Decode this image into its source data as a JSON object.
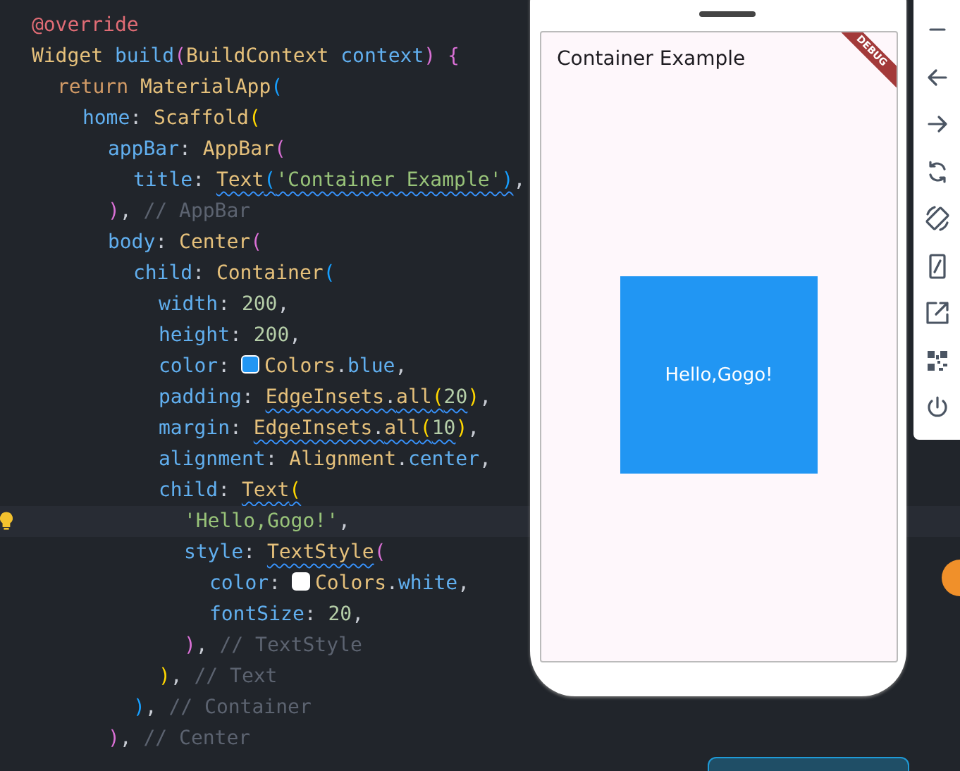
{
  "editor": {
    "lines": [
      {
        "tokens": [
          {
            "t": "@override",
            "kind": "deco"
          }
        ]
      },
      {
        "tokens": [
          {
            "t": "Widget ",
            "kind": "type"
          },
          {
            "t": "build",
            "kind": "fn"
          },
          {
            "t": "(",
            "kind": "b1"
          },
          {
            "t": "BuildContext ",
            "kind": "type"
          },
          {
            "t": "context",
            "kind": "fn"
          },
          {
            "t": ") {",
            "kind": "b1"
          }
        ],
        "children": [
          {
            "tokens": [
              {
                "t": "return ",
                "kind": "kw"
              },
              {
                "t": "MaterialApp",
                "kind": "type"
              },
              {
                "t": "(",
                "kind": "b3"
              }
            ],
            "children": [
              {
                "tokens": [
                  {
                    "t": "home",
                    "kind": "prop"
                  },
                  {
                    "t": ": ",
                    "kind": "punct"
                  },
                  {
                    "t": "Scaffold",
                    "kind": "type"
                  },
                  {
                    "t": "(",
                    "kind": "b2"
                  }
                ],
                "children": [
                  {
                    "tokens": [
                      {
                        "t": "appBar",
                        "kind": "prop"
                      },
                      {
                        "t": ": ",
                        "kind": "punct"
                      },
                      {
                        "t": "AppBar",
                        "kind": "type"
                      },
                      {
                        "t": "(",
                        "kind": "b1"
                      }
                    ],
                    "children": [
                      {
                        "tokens": [
                          {
                            "t": "title",
                            "kind": "prop"
                          },
                          {
                            "t": ": ",
                            "kind": "punct"
                          },
                          {
                            "t": "Text",
                            "kind": "type",
                            "warn": true
                          },
                          {
                            "t": "(",
                            "kind": "b3",
                            "warn": true
                          },
                          {
                            "t": "'Container Example'",
                            "kind": "str",
                            "warn": true
                          },
                          {
                            "t": ")",
                            "kind": "b3",
                            "warn": true
                          },
                          {
                            "t": ",",
                            "kind": "punct"
                          }
                        ]
                      }
                    ]
                  },
                  {
                    "tokens": [
                      {
                        "t": ")",
                        "kind": "b1"
                      },
                      {
                        "t": ", ",
                        "kind": "punct"
                      },
                      {
                        "t": "// AppBar",
                        "kind": "comment"
                      }
                    ]
                  },
                  {
                    "tokens": [
                      {
                        "t": "body",
                        "kind": "prop"
                      },
                      {
                        "t": ": ",
                        "kind": "punct"
                      },
                      {
                        "t": "Center",
                        "kind": "type"
                      },
                      {
                        "t": "(",
                        "kind": "b1"
                      }
                    ],
                    "children": [
                      {
                        "tokens": [
                          {
                            "t": "child",
                            "kind": "prop"
                          },
                          {
                            "t": ": ",
                            "kind": "punct"
                          },
                          {
                            "t": "Container",
                            "kind": "type"
                          },
                          {
                            "t": "(",
                            "kind": "b3"
                          }
                        ],
                        "children": [
                          {
                            "tokens": [
                              {
                                "t": "width",
                                "kind": "prop"
                              },
                              {
                                "t": ": ",
                                "kind": "punct"
                              },
                              {
                                "t": "200",
                                "kind": "num"
                              },
                              {
                                "t": ",",
                                "kind": "punct"
                              }
                            ]
                          },
                          {
                            "tokens": [
                              {
                                "t": "height",
                                "kind": "prop"
                              },
                              {
                                "t": ": ",
                                "kind": "punct"
                              },
                              {
                                "t": "200",
                                "kind": "num"
                              },
                              {
                                "t": ",",
                                "kind": "punct"
                              }
                            ]
                          },
                          {
                            "tokens": [
                              {
                                "t": "color",
                                "kind": "prop"
                              },
                              {
                                "t": ": ",
                                "kind": "punct"
                              },
                              {
                                "kind": "swatch",
                                "color": "#2196f3"
                              },
                              {
                                "t": "Colors",
                                "kind": "type"
                              },
                              {
                                "t": ".",
                                "kind": "punct"
                              },
                              {
                                "t": "blue",
                                "kind": "prop"
                              },
                              {
                                "t": ",",
                                "kind": "punct"
                              }
                            ]
                          },
                          {
                            "tokens": [
                              {
                                "t": "padding",
                                "kind": "prop"
                              },
                              {
                                "t": ": ",
                                "kind": "punct"
                              },
                              {
                                "t": "EdgeInsets",
                                "kind": "type",
                                "warn": true
                              },
                              {
                                "t": ".",
                                "kind": "punct",
                                "warn": true
                              },
                              {
                                "t": "all",
                                "kind": "type",
                                "warn": true
                              },
                              {
                                "t": "(",
                                "kind": "b2",
                                "warn": true
                              },
                              {
                                "t": "20",
                                "kind": "num",
                                "warn": true
                              },
                              {
                                "t": ")",
                                "kind": "b2"
                              },
                              {
                                "t": ",",
                                "kind": "punct"
                              }
                            ]
                          },
                          {
                            "tokens": [
                              {
                                "t": "margin",
                                "kind": "prop"
                              },
                              {
                                "t": ": ",
                                "kind": "punct"
                              },
                              {
                                "t": "EdgeInsets",
                                "kind": "type",
                                "warn": true
                              },
                              {
                                "t": ".",
                                "kind": "punct",
                                "warn": true
                              },
                              {
                                "t": "all",
                                "kind": "type",
                                "warn": true
                              },
                              {
                                "t": "(",
                                "kind": "b2",
                                "warn": true
                              },
                              {
                                "t": "10",
                                "kind": "num",
                                "warn": true
                              },
                              {
                                "t": ")",
                                "kind": "b2"
                              },
                              {
                                "t": ",",
                                "kind": "punct"
                              }
                            ]
                          },
                          {
                            "tokens": [
                              {
                                "t": "alignment",
                                "kind": "prop"
                              },
                              {
                                "t": ": ",
                                "kind": "punct"
                              },
                              {
                                "t": "Alignment",
                                "kind": "type"
                              },
                              {
                                "t": ".",
                                "kind": "punct"
                              },
                              {
                                "t": "center",
                                "kind": "prop"
                              },
                              {
                                "t": ",",
                                "kind": "punct"
                              }
                            ]
                          },
                          {
                            "tokens": [
                              {
                                "t": "child",
                                "kind": "prop"
                              },
                              {
                                "t": ": ",
                                "kind": "punct"
                              },
                              {
                                "t": "Text",
                                "kind": "type",
                                "warn": true
                              },
                              {
                                "t": "(",
                                "kind": "b2",
                                "warn": true
                              }
                            ],
                            "children": [
                              {
                                "current": true,
                                "tokens": [
                                  {
                                    "t": "'Hello,Gogo!'",
                                    "kind": "str"
                                  },
                                  {
                                    "t": ",",
                                    "kind": "punct"
                                  }
                                ]
                              },
                              {
                                "tokens": [
                                  {
                                    "t": "style",
                                    "kind": "prop"
                                  },
                                  {
                                    "t": ": ",
                                    "kind": "punct"
                                  },
                                  {
                                    "t": "TextStyle",
                                    "kind": "type",
                                    "warn": true
                                  },
                                  {
                                    "t": "(",
                                    "kind": "b1"
                                  }
                                ],
                                "children": [
                                  {
                                    "tokens": [
                                      {
                                        "t": "color",
                                        "kind": "prop"
                                      },
                                      {
                                        "t": ": ",
                                        "kind": "punct"
                                      },
                                      {
                                        "kind": "swatch",
                                        "color": "#ffffff"
                                      },
                                      {
                                        "t": "Colors",
                                        "kind": "type"
                                      },
                                      {
                                        "t": ".",
                                        "kind": "punct"
                                      },
                                      {
                                        "t": "white",
                                        "kind": "prop"
                                      },
                                      {
                                        "t": ",",
                                        "kind": "punct"
                                      }
                                    ]
                                  },
                                  {
                                    "tokens": [
                                      {
                                        "t": "fontSize",
                                        "kind": "prop"
                                      },
                                      {
                                        "t": ": ",
                                        "kind": "punct"
                                      },
                                      {
                                        "t": "20",
                                        "kind": "num"
                                      },
                                      {
                                        "t": ",",
                                        "kind": "punct"
                                      }
                                    ]
                                  }
                                ]
                              },
                              {
                                "tokens": [
                                  {
                                    "t": ")",
                                    "kind": "b1"
                                  },
                                  {
                                    "t": ", ",
                                    "kind": "punct"
                                  },
                                  {
                                    "t": "// TextStyle",
                                    "kind": "comment"
                                  }
                                ]
                              }
                            ]
                          },
                          {
                            "tokens": [
                              {
                                "t": ")",
                                "kind": "b2"
                              },
                              {
                                "t": ", ",
                                "kind": "punct"
                              },
                              {
                                "t": "// Text",
                                "kind": "comment"
                              }
                            ]
                          }
                        ]
                      },
                      {
                        "tokens": [
                          {
                            "t": ")",
                            "kind": "b3"
                          },
                          {
                            "t": ", ",
                            "kind": "punct"
                          },
                          {
                            "t": "// Container",
                            "kind": "comment"
                          }
                        ]
                      }
                    ]
                  },
                  {
                    "tokens": [
                      {
                        "t": ")",
                        "kind": "b1"
                      },
                      {
                        "t": ", ",
                        "kind": "punct"
                      },
                      {
                        "t": "// Center",
                        "kind": "comment"
                      }
                    ]
                  }
                ]
              }
            ]
          }
        ]
      }
    ]
  },
  "device": {
    "app_bar_title": "Container Example",
    "banner": "DEBUG",
    "box_text": "Hello,Gogo!"
  },
  "toolbar": {
    "items": [
      {
        "kind": "minimize"
      },
      {
        "kind": "back"
      },
      {
        "kind": "forward"
      },
      {
        "kind": "reload"
      },
      {
        "kind": "rotate"
      },
      {
        "kind": "resize"
      },
      {
        "kind": "external"
      },
      {
        "kind": "qr"
      },
      {
        "kind": "power"
      }
    ]
  }
}
